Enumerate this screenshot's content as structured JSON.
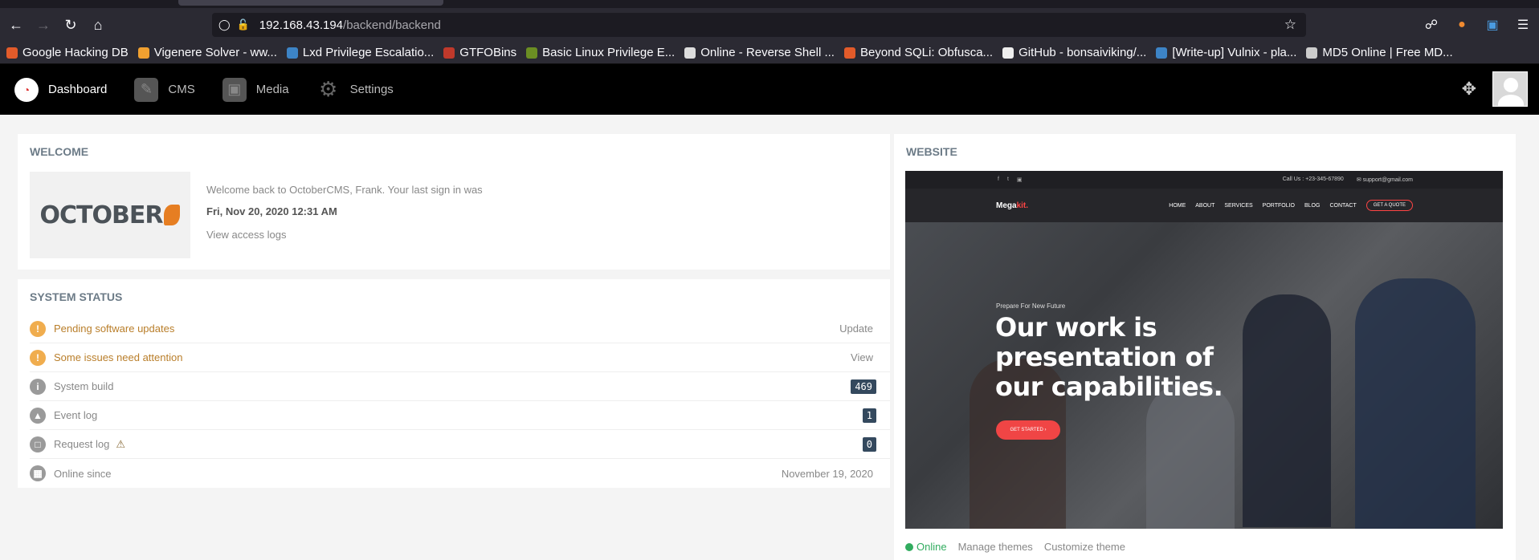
{
  "browser": {
    "url_host": "192.168.43.194",
    "url_path": "/backend/backend",
    "bookmarks": [
      {
        "label": "Google Hacking DB",
        "color": "#e25b2a"
      },
      {
        "label": "Vigenere Solver - ww...",
        "color": "#f0a030"
      },
      {
        "label": "Lxd Privilege Escalatio...",
        "color": "#3d84c6"
      },
      {
        "label": "GTFOBins",
        "color": "#c0392b"
      },
      {
        "label": "Basic Linux Privilege E...",
        "color": "#6b8e23"
      },
      {
        "label": "Online - Reverse Shell ...",
        "color": "#dddddd"
      },
      {
        "label": "Beyond SQLi: Obfusca...",
        "color": "#e25b2a"
      },
      {
        "label": "GitHub - bonsaiviking/...",
        "color": "#eeeeee"
      },
      {
        "label": "[Write-up] Vulnix - pla...",
        "color": "#3d84c6"
      },
      {
        "label": "MD5 Online | Free MD...",
        "color": "#cccccc"
      }
    ]
  },
  "header": {
    "nav": [
      {
        "label": "Dashboard",
        "icon": "dashboard-icon"
      },
      {
        "label": "CMS",
        "icon": "cms-icon"
      },
      {
        "label": "Media",
        "icon": "media-icon"
      },
      {
        "label": "Settings",
        "icon": "settings-icon"
      }
    ]
  },
  "welcome": {
    "title": "Welcome",
    "logo_text": "OCTOBER",
    "message": "Welcome back to OctoberCMS, Frank. Your last sign in was",
    "last_signin": "Fri, Nov 20, 2020 12:31 AM",
    "access_logs_link": "View access logs"
  },
  "system_status": {
    "title": "System status",
    "rows": [
      {
        "label": "Pending software updates",
        "right": "Update"
      },
      {
        "label": "Some issues need attention",
        "right": "View"
      },
      {
        "label": "System build",
        "badge": "469"
      },
      {
        "label": "Event log",
        "badge": "1"
      },
      {
        "label": "Request log",
        "badge": "0"
      },
      {
        "label": "Online since",
        "right": "November 19, 2020"
      }
    ]
  },
  "website": {
    "title": "Website",
    "preview": {
      "call_us": "Call Us : +23-345-67890",
      "email": "support@gmail.com",
      "brand": "Mega",
      "brand_accent": "kit.",
      "menu": [
        "HOME",
        "ABOUT",
        "SERVICES",
        "PORTFOLIO",
        "BLOG",
        "CONTACT"
      ],
      "quote_button": "GET A QUOTE",
      "eyebrow": "Prepare For New Future",
      "headline": "Our work is presentation of our capabilities.",
      "cta": "GET STARTED"
    },
    "status": "Online",
    "manage_themes": "Manage themes",
    "customize_theme": "Customize theme"
  }
}
